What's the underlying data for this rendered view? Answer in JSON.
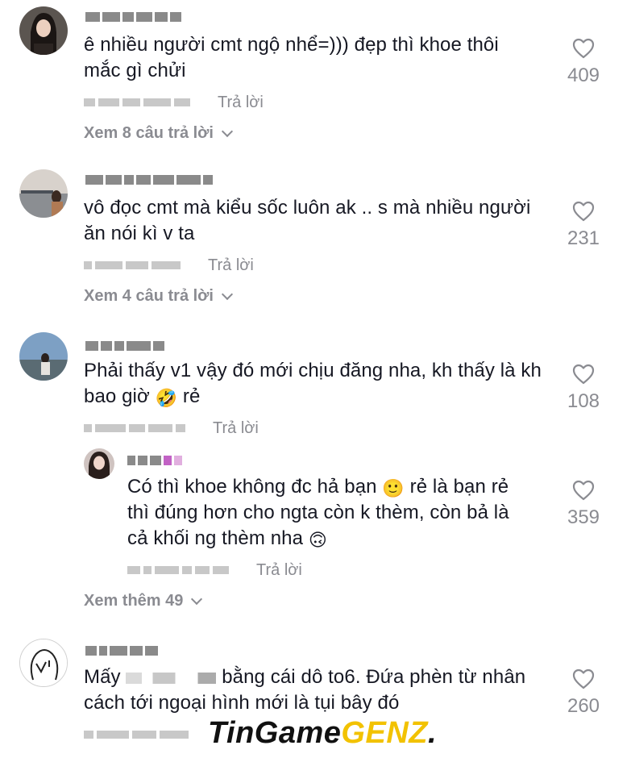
{
  "colors": {
    "text": "#161823",
    "muted": "#8a8b91",
    "accent": "#f2c200"
  },
  "comments": [
    {
      "text": "ê nhiều người cmt ngộ nhể=))) đẹp thì khoe thôi mắc gì chửi",
      "reply_label": "Trả lời",
      "likes": "409",
      "view_replies": "Xem 8 câu trả lời"
    },
    {
      "text": "vô đọc cmt mà kiểu sốc luôn ak .. s mà nhiều người ăn nói kì v ta",
      "reply_label": "Trả lời",
      "likes": "231",
      "view_replies": "Xem 4 câu trả lời"
    },
    {
      "text_before": "Phải thấy v1 vậy đó mới chịu đăng nha, kh thấy là kh bao giờ ",
      "emoji": "🤣",
      "text_after": " rẻ",
      "reply_label": "Trả lời",
      "likes": "108",
      "reply": {
        "text_part1": "Có thì khoe không đc hả bạn ",
        "emoji1": "🙂",
        "text_part2": " rẻ là bạn rẻ thì đúng hơn cho ngta còn k thèm, còn bả là cả khối ng thèm nha ",
        "emoji2": "🙃",
        "reply_label": "Trả lời",
        "likes": "359"
      },
      "view_more": "Xem thêm 49"
    },
    {
      "text_before": "Mấy ",
      "text_after": " bằng cái dô to6. Đứa phèn từ nhân cách tới ngoại hình mới là tụi bây đó",
      "likes": "260"
    }
  ],
  "watermark": {
    "part1": "TinGame",
    "part2": "GENZ",
    "part3": "."
  }
}
